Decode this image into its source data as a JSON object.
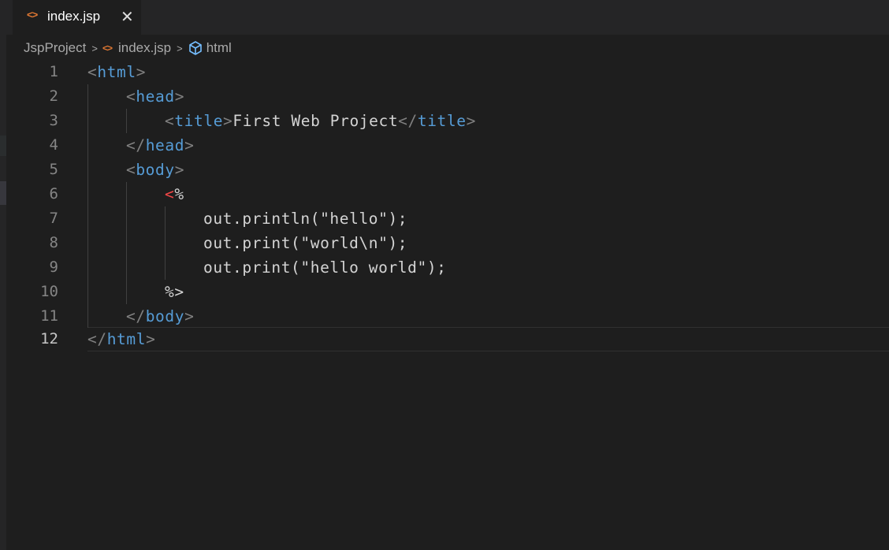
{
  "tab": {
    "icon": "<>",
    "label": "index.jsp",
    "close": "✕"
  },
  "breadcrumb": {
    "project": "JspProject",
    "sep": ">",
    "file_icon": "<>",
    "file": "index.jsp",
    "symbol": "html"
  },
  "lines": [
    {
      "num": "1"
    },
    {
      "num": "2"
    },
    {
      "num": "3"
    },
    {
      "num": "4"
    },
    {
      "num": "5"
    },
    {
      "num": "6"
    },
    {
      "num": "7"
    },
    {
      "num": "8"
    },
    {
      "num": "9"
    },
    {
      "num": "10"
    },
    {
      "num": "11"
    },
    {
      "num": "12"
    }
  ],
  "code": {
    "lt": "<",
    "gt": ">",
    "close_lt": "</",
    "html": "html",
    "head": "head",
    "title": "title",
    "body": "body",
    "title_text": "First Web Project",
    "jsp_lt": "<",
    "jsp_pct": "%",
    "jsp_close": "%>",
    "stmt1": "out.println(\"hello\");",
    "stmt2": "out.print(\"world\\n\");",
    "stmt3": "out.print(\"hello world\");"
  },
  "colors": {
    "tag": "#569cd6",
    "bracket": "#808080",
    "jsp_open": "#f44747",
    "file_icon": "#e37933"
  },
  "active_line": "12"
}
